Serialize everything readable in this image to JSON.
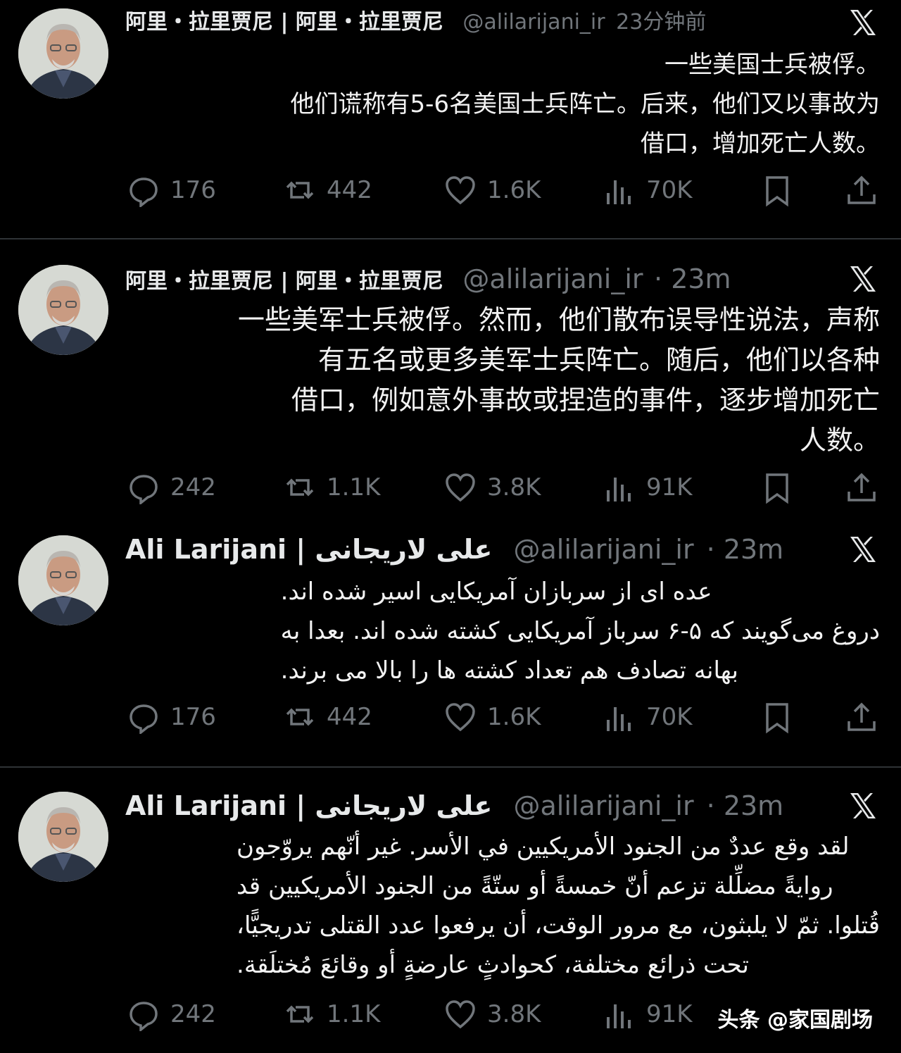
{
  "tweets": [
    {
      "name": "阿里・拉里贾尼 | 阿里・拉里贾尼",
      "handle": "@alilarijani_ir",
      "time": "23分钟前",
      "lines": [
        "一些美国士兵被俘。",
        "他们谎称有5-6名美国士兵阵亡。后来，他们又以事故为",
        "借口，增加死亡人数。"
      ],
      "stats": {
        "replies": "176",
        "reposts": "442",
        "likes": "1.6K",
        "views": "70K"
      }
    },
    {
      "name": "阿里・拉里贾尼 | 阿里・拉里贾尼",
      "handle": "@alilarijani_ir",
      "time": "· 23m",
      "lines": [
        "一些美军士兵被俘。然而，他们散布误导性说法，声称",
        "有五名或更多美军士兵阵亡。随后，他们以各种",
        "借口，例如意外事故或捏造的事件，逐步增加死亡",
        "人数。"
      ],
      "stats": {
        "replies": "242",
        "reposts": "1.1K",
        "likes": "3.8K",
        "views": "91K"
      }
    },
    {
      "name": "Ali Larijani | علی لاریجانی",
      "handle": "@alilarijani_ir",
      "time": "· 23m",
      "lines": [
        "عده ای از سربازان آمریکایی اسیر شده اند.",
        "دروغ می‌گویند که ۵-۶ سرباز آمریکایی کشته شده اند. بعدا به",
        "بهانه تصادف هم تعداد کشته ها را بالا می برند."
      ],
      "stats": {
        "replies": "176",
        "reposts": "442",
        "likes": "1.6K",
        "views": "70K"
      }
    },
    {
      "name": "Ali Larijani | علی لاریجانی",
      "handle": "@alilarijani_ir",
      "time": "· 23m",
      "lines": [
        "لقد وقع عددٌ من الجنود الأمريكيين في الأسر. غير أنّهم يروّجون",
        "روايةً مضلِّلة تزعم أنّ خمسةً أو ستّةً من الجنود الأمريكيين قد",
        "قُتلوا. ثمّ لا يلبثون، مع مرور الوقت، أن يرفعوا عدد القتلى تدريجيًّا،",
        "تحت ذرائع مختلفة، كحوادثٍ عارضةٍ أو وقائعَ مُختلَقة."
      ],
      "stats": {
        "replies": "242",
        "reposts": "1.1K",
        "likes": "3.8K",
        "views": "91K"
      }
    }
  ],
  "icons": {
    "reply": "reply-icon",
    "repost": "repost-icon",
    "like": "like-icon",
    "views": "views-icon",
    "bookmark": "bookmark-icon",
    "share": "share-icon",
    "logo": "x-logo-icon"
  },
  "colors": {
    "background": "#000000",
    "text": "#e7e9ea",
    "muted": "#71767b",
    "divider": "#2f3336"
  },
  "watermark": "头条 @家国剧场"
}
